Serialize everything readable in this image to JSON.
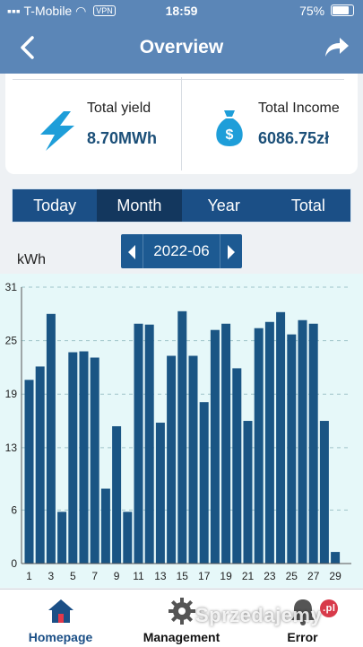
{
  "status_bar": {
    "carrier": "T-Mobile",
    "vpn": "VPN",
    "time": "18:59",
    "battery": "75%"
  },
  "header": {
    "title": "Overview"
  },
  "summary": {
    "yield_label": "Total yield",
    "yield_value": "8.70MWh",
    "income_label": "Total Income",
    "income_value": "6086.75zł"
  },
  "tabs": [
    {
      "label": "Today",
      "active": false
    },
    {
      "label": "Month",
      "active": true
    },
    {
      "label": "Year",
      "active": false
    },
    {
      "label": "Total",
      "active": false
    }
  ],
  "date_picker": {
    "value": "2022-06"
  },
  "chart_unit": "kWh",
  "chart_data": {
    "type": "bar",
    "ylabel": "kWh",
    "ylim": [
      0,
      31
    ],
    "yticks": [
      0,
      6,
      13,
      19,
      25,
      31
    ],
    "xtick_labels": [
      "1",
      "3",
      "5",
      "7",
      "9",
      "11",
      "13",
      "15",
      "17",
      "19",
      "21",
      "23",
      "25",
      "27",
      "29"
    ],
    "categories": [
      "1",
      "2",
      "3",
      "4",
      "5",
      "6",
      "7",
      "8",
      "9",
      "10",
      "11",
      "12",
      "13",
      "14",
      "15",
      "16",
      "17",
      "18",
      "19",
      "20",
      "21",
      "22",
      "23",
      "24",
      "25",
      "26",
      "27",
      "28",
      "29",
      "30"
    ],
    "values": [
      20.6,
      22.1,
      28.0,
      5.8,
      23.7,
      23.8,
      23.1,
      8.4,
      15.4,
      5.8,
      26.9,
      26.8,
      15.8,
      23.3,
      28.3,
      23.3,
      18.1,
      26.2,
      26.9,
      21.9,
      16.0,
      26.4,
      27.1,
      28.2,
      25.7,
      27.3,
      26.9,
      16.0,
      1.3,
      0
    ],
    "grid": true,
    "bar_color": "#1a5584",
    "background_color": "#e6f8f9"
  },
  "bottom_nav": [
    {
      "label": "Homepage",
      "icon": "home-icon",
      "active": true
    },
    {
      "label": "Management",
      "icon": "gear-icon",
      "active": false
    },
    {
      "label": "Error",
      "icon": "alert-icon",
      "active": false
    }
  ],
  "watermark": {
    "text": "Sprzedajemy",
    "badge": ".pl"
  }
}
